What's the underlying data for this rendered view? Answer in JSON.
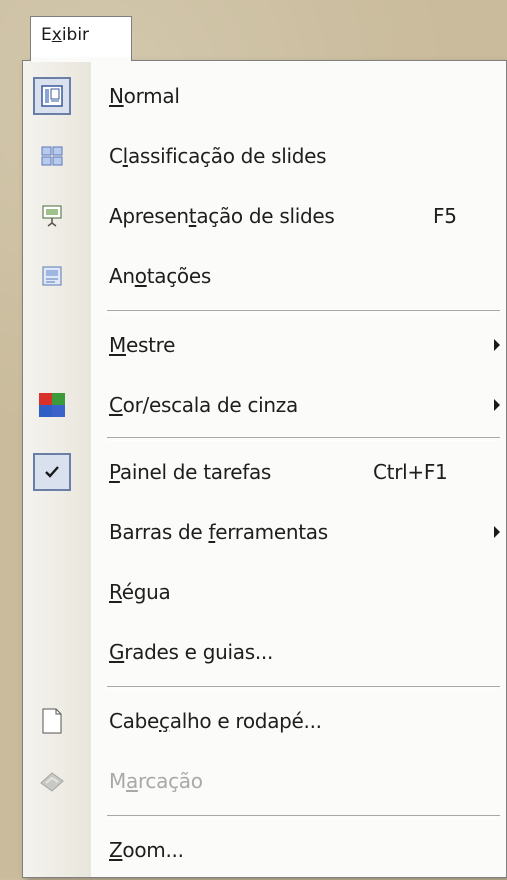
{
  "menubar": {
    "title_prefix": "E",
    "title_accel": "x",
    "title_suffix": "ibir"
  },
  "menu": {
    "items": [
      {
        "pre": "",
        "accel": "N",
        "post": "ormal",
        "icon": "normal-view-icon"
      },
      {
        "pre": "C",
        "accel": "l",
        "post": "assificação de slides",
        "icon": "slide-sorter-icon"
      },
      {
        "pre": "Apresen",
        "accel": "t",
        "post": "ação de slides",
        "shortcut": "F5",
        "icon": "slide-show-icon"
      },
      {
        "pre": "An",
        "accel": "o",
        "post": "tações",
        "icon": "notes-page-icon"
      },
      {
        "pre": "",
        "accel": "M",
        "post": "estre",
        "submenu": true
      },
      {
        "pre": "",
        "accel": "C",
        "post": "or/escala de cinza",
        "submenu": true,
        "icon": "color-grayscale-icon"
      },
      {
        "pre": "",
        "accel": "P",
        "post": "ainel de tarefas",
        "shortcut": "Ctrl+F1",
        "checked": true,
        "icon": "check-icon"
      },
      {
        "pre": "Barras de ",
        "accel": "f",
        "post": "erramentas",
        "submenu": true
      },
      {
        "pre": "",
        "accel": "R",
        "post": "égua"
      },
      {
        "pre": "",
        "accel": "G",
        "post": "rades e guias...",
        "icon": ""
      },
      {
        "pre": "Cabe",
        "accel": "ç",
        "post": "alho e rodapé...",
        "icon": "header-footer-icon"
      },
      {
        "pre": "M",
        "accel": "a",
        "post": "rcação",
        "disabled": true,
        "icon": "markup-icon"
      },
      {
        "pre": "",
        "accel": "Z",
        "post": "oom...",
        "icon": ""
      }
    ]
  },
  "colors": {
    "menu_bg": "#fbfbf9",
    "gutter": "#e9e6dc",
    "checked_border": "#6a7ea8",
    "disabled_text": "#a9a9a6"
  }
}
